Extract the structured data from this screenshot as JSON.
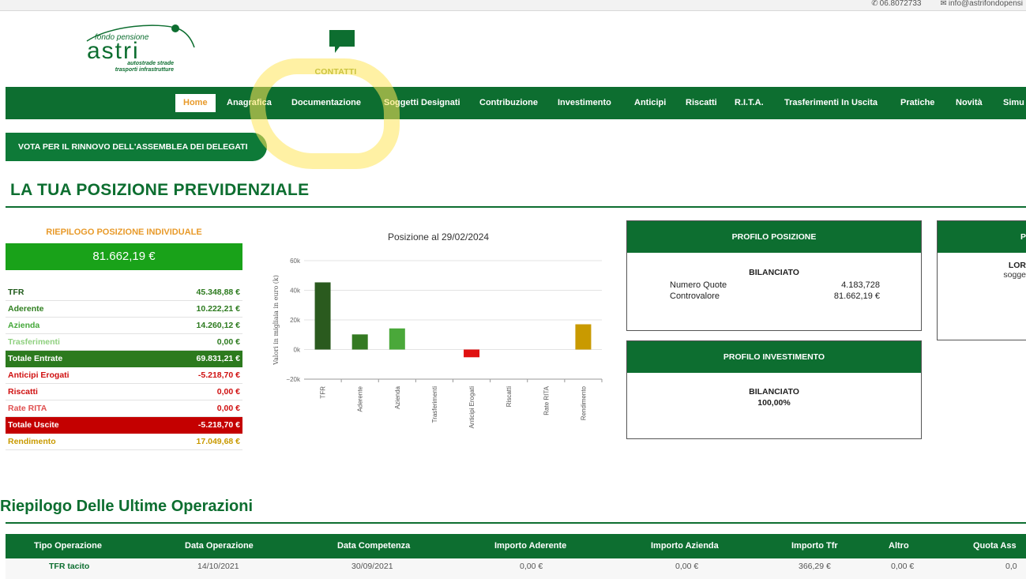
{
  "top": {
    "phone": "06.8072733",
    "email": "info@astrifondopensi"
  },
  "logo": {
    "top_text": "fondo pensione",
    "brand": "astri",
    "sub1": "autostrade strade",
    "sub2": "trasporti infrastrutture"
  },
  "contatti": "CONTATTI",
  "nav": [
    {
      "label": "Home",
      "active": true
    },
    {
      "label": "Anagrafica"
    },
    {
      "label": "Documentazione"
    },
    {
      "label": "Soggetti Designati"
    },
    {
      "label": "Contribuzione"
    },
    {
      "label": "Investimento"
    },
    {
      "label": "Anticipi"
    },
    {
      "label": "Riscatti"
    },
    {
      "label": "R.I.T.A."
    },
    {
      "label": "Trasferimenti In Uscita"
    },
    {
      "label": "Pratiche"
    },
    {
      "label": "Novità"
    },
    {
      "label": "Simu"
    }
  ],
  "vote_button": "VOTA PER IL RINNOVO DELL'ASSEMBLEA DEI DELEGATI",
  "section_title": "LA TUA POSIZIONE PREVIDENZIALE",
  "riepilogo": {
    "title": "RIEPILOGO POSIZIONE INDIVIDUALE",
    "total": "81.662,19 €",
    "rows": [
      {
        "label": "TFR",
        "value": "45.348,88 €",
        "color": "#1f5a1a",
        "bg": ""
      },
      {
        "label": "Aderente",
        "value": "10.222,21 €",
        "color": "#2f7f1f",
        "bg": ""
      },
      {
        "label": "Azienda",
        "value": "14.260,12 €",
        "color": "#45a83a",
        "bg": ""
      },
      {
        "label": "Trasferimenti",
        "value": "0,00 €",
        "color": "#8fd07f",
        "bg": ""
      },
      {
        "label": "Totale Entrate",
        "value": "69.831,21 €",
        "color": "#ffffff",
        "bg": "#2c7a1e"
      },
      {
        "label": "Anticipi Erogati",
        "value": "-5.218,70 €",
        "color": "#d01010",
        "bg": ""
      },
      {
        "label": "Riscatti",
        "value": "0,00 €",
        "color": "#d01010",
        "bg": ""
      },
      {
        "label": "Rate RITA",
        "value": "0,00 €",
        "color": "#e05050",
        "bg": ""
      },
      {
        "label": "Totale Uscite",
        "value": "-5.218,70 €",
        "color": "#ffffff",
        "bg": "#c40000"
      },
      {
        "label": "Rendimento",
        "value": "17.049,68 €",
        "color": "#c99a00",
        "bg": ""
      }
    ]
  },
  "chart_data": {
    "type": "bar",
    "title": "Posizione al 29/02/2024",
    "ylabel": "Valori in migliaia in euro (k)",
    "xlabel": "",
    "ylim": [
      -20,
      60
    ],
    "yticks": [
      "60k",
      "40k",
      "20k",
      "0k",
      "−20k"
    ],
    "categories": [
      "TFR",
      "Aderente",
      "Azienda",
      "Trasferimenti",
      "Anticipi Erogati",
      "Riscatti",
      "Rate RITA",
      "Rendimento"
    ],
    "values": [
      45.35,
      10.22,
      14.26,
      0,
      -5.22,
      0,
      0,
      17.05
    ],
    "colors": [
      "#2a5a1e",
      "#347a22",
      "#4aa83a",
      "#8fd07f",
      "#e01010",
      "#d01010",
      "#e05050",
      "#c99a00"
    ],
    "grid": true
  },
  "profilo_posizione": {
    "title": "PROFILO POSIZIONE",
    "name": "BILANCIATO",
    "quote_label": "Numero Quote",
    "quote_value": "4.183,728",
    "contr_label": "Controvalore",
    "contr_value": "81.662,19 €"
  },
  "profilo_investimento": {
    "title": "PROFILO INVESTIMENTO",
    "name": "BILANCIATO",
    "pct": "100,00%"
  },
  "side_card": {
    "title": "P",
    "line1": "LOR",
    "line2": "sogge"
  },
  "operazioni": {
    "title": "Riepilogo Delle Ultime Operazioni",
    "headers": [
      "Tipo Operazione",
      "Data Operazione",
      "Data Competenza",
      "Importo Aderente",
      "Importo Azienda",
      "Importo Tfr",
      "Altro",
      "Quota Ass"
    ],
    "rows": [
      [
        "TFR tacito",
        "14/10/2021",
        "30/09/2021",
        "0,00 €",
        "0,00 €",
        "366,29 €",
        "0,00 €",
        "0,0"
      ]
    ]
  }
}
